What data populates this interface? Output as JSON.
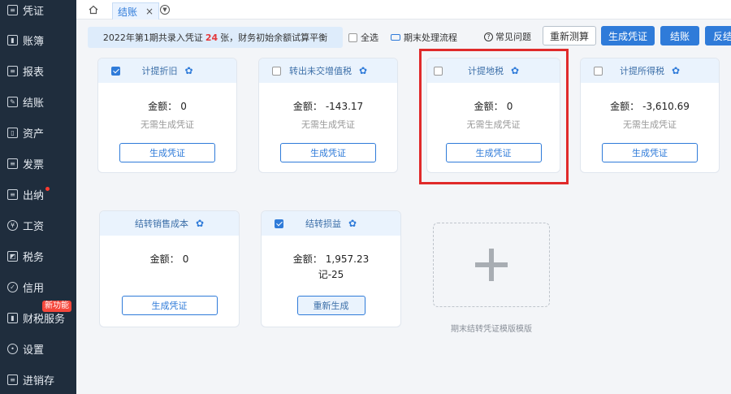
{
  "sidebar": {
    "items": [
      {
        "label": "凭证",
        "icon": "voucher-icon"
      },
      {
        "label": "账簿",
        "icon": "ledger-icon"
      },
      {
        "label": "报表",
        "icon": "report-icon"
      },
      {
        "label": "结账",
        "icon": "closing-icon"
      },
      {
        "label": "资产",
        "icon": "assets-icon"
      },
      {
        "label": "发票",
        "icon": "invoice-icon"
      },
      {
        "label": "出纳",
        "icon": "cashier-icon"
      },
      {
        "label": "工资",
        "icon": "salary-icon"
      },
      {
        "label": "税务",
        "icon": "tax-icon"
      },
      {
        "label": "信用",
        "icon": "credit-icon"
      },
      {
        "label": "财税服务",
        "icon": "finance-service-icon"
      },
      {
        "label": "设置",
        "icon": "settings-icon"
      },
      {
        "label": "进销存",
        "icon": "inventory-icon"
      }
    ],
    "new_badge": "新功能"
  },
  "tabs": {
    "active_label": "结账",
    "close": "×"
  },
  "toolbar": {
    "notice_prefix": "2022年第1期共录入凭证",
    "notice_count": "24",
    "notice_suffix": "张，财务初始余额试算平衡",
    "select_all": "全选",
    "flow": "期末处理流程",
    "faq": "常见问题",
    "remeasure": "重新测算",
    "generate": "生成凭证",
    "close_books": "结账",
    "reverse": "反结"
  },
  "cards": [
    {
      "title": "计提折旧",
      "checked": true,
      "amount_label": "金额：",
      "amount": "0",
      "sub": "无需生成凭证",
      "button": "生成凭证"
    },
    {
      "title": "转出未交增值税",
      "checked": false,
      "amount_label": "金额：",
      "amount": "-143.17",
      "sub": "无需生成凭证",
      "button": "生成凭证"
    },
    {
      "title": "计提地税",
      "checked": false,
      "amount_label": "金额：",
      "amount": "0",
      "sub": "无需生成凭证",
      "button": "生成凭证"
    },
    {
      "title": "计提所得税",
      "checked": false,
      "amount_label": "金额：",
      "amount": "-3,610.69",
      "sub": "无需生成凭证",
      "button": "生成凭证"
    },
    {
      "title": "结转销售成本",
      "checked": false,
      "amount_label": "金额：",
      "amount": "0",
      "sub": "",
      "button": "生成凭证"
    },
    {
      "title": "结转损益",
      "checked": true,
      "amount_label": "金额：",
      "amount": "1,957.23",
      "voucher_no": "记-25",
      "button": "重新生成"
    }
  ],
  "add_template": {
    "label": "期末结转凭证模版模版"
  },
  "colors": {
    "accent": "#2f7bd9",
    "sidebar_bg": "#1f2d3d",
    "highlight": "#e02a2a"
  }
}
